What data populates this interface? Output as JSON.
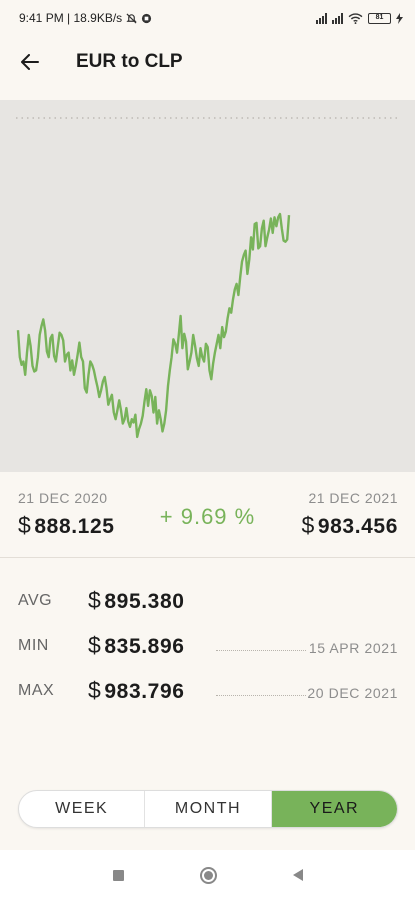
{
  "status_bar": {
    "left_text": "9:41 PM | 18.9KB/s",
    "battery": "81"
  },
  "header": {
    "title": "EUR to CLP",
    "back_icon": "arrow-left-icon"
  },
  "chart": {
    "line_color": "#78b35a",
    "background": "#e7e5e2"
  },
  "chart_data": {
    "type": "line",
    "title": "",
    "xlabel": "",
    "ylabel": "",
    "x_range": [
      "21 DEC 2020",
      "21 DEC 2021"
    ],
    "ylim": [
      835.896,
      983.796
    ],
    "series": [
      {
        "name": "",
        "values": [
          888.1,
          876.0,
          872.5,
          874.0,
          868.0,
          878.0,
          886.0,
          881.0,
          872.0,
          869.5,
          870.0,
          876.0,
          886.0,
          890.0,
          893.0,
          888.0,
          878.5,
          876.0,
          884.5,
          886.0,
          876.5,
          874.0,
          880.5,
          887.0,
          886.0,
          883.5,
          874.0,
          877.0,
          878.0,
          870.0,
          874.5,
          868.0,
          872.0,
          877.0,
          882.5,
          876.0,
          874.0,
          862.0,
          860.0,
          868.0,
          874.0,
          872.5,
          870.0,
          866.0,
          862.5,
          858.0,
          861.0,
          865.0,
          867.0,
          862.0,
          854.5,
          857.0,
          859.0,
          851.0,
          848.0,
          852.0,
          856.5,
          852.0,
          846.0,
          848.0,
          853.0,
          847.0,
          844.5,
          848.0,
          846.5,
          850.0,
          840.0,
          843.5,
          846.0,
          849.5,
          856.0,
          861.5,
          854.0,
          861.0,
          858.5,
          851.0,
          858.0,
          846.0,
          852.0,
          848.0,
          842.5,
          846.0,
          852.0,
          863.0,
          870.0,
          876.0,
          884.0,
          882.0,
          878.0,
          886.0,
          894.5,
          880.0,
          886.5,
          883.0,
          870.5,
          874.0,
          878.0,
          886.0,
          881.0,
          875.5,
          872.0,
          880.0,
          876.0,
          874.0,
          882.0,
          880.5,
          870.0,
          866.0,
          873.0,
          878.0,
          882.0,
          886.0,
          880.0,
          889.5,
          885.0,
          887.5,
          893.5,
          898.0,
          896.0,
          902.0,
          906.5,
          909.0,
          904.0,
          912.0,
          919.0,
          922.0,
          924.0,
          913.5,
          920.0,
          930.0,
          924.5,
          936.0,
          936.5,
          925.0,
          926.0,
          934.0,
          937.5,
          926.0,
          930.0,
          933.5,
          938.5,
          932.0,
          939.0,
          935.0,
          939.0,
          940.5,
          934.0,
          928.5,
          928.0,
          929.0,
          940.0
        ]
      }
    ]
  },
  "period": {
    "start_date": "21 DEC 2020",
    "start_currency": "$",
    "start_rate": "888.125",
    "change": "+ 9.69 %",
    "end_date": "21 DEC 2021",
    "end_currency": "$",
    "end_rate": "983.456"
  },
  "stats": {
    "avg": {
      "label": "AVG",
      "currency": "$",
      "value": "895.380"
    },
    "min": {
      "label": "MIN",
      "currency": "$",
      "value": "835.896",
      "date": "15 APR 2021"
    },
    "max": {
      "label": "MAX",
      "currency": "$",
      "value": "983.796",
      "date": "20 DEC 2021"
    }
  },
  "range_toggle": {
    "options": [
      "WEEK",
      "MONTH",
      "YEAR"
    ],
    "selected": "YEAR"
  },
  "nav_bar": {
    "icons": [
      "recents-square-icon",
      "home-circle-icon",
      "back-triangle-icon"
    ]
  }
}
